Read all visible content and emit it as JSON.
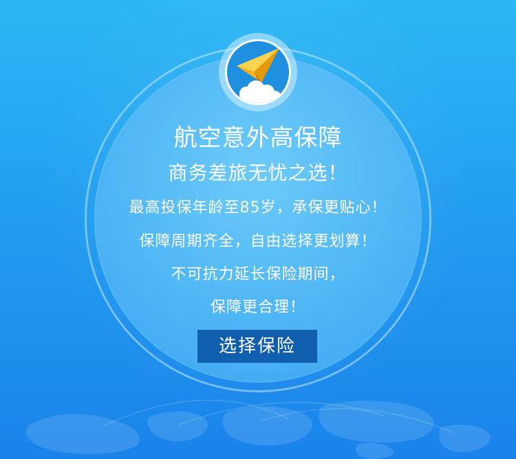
{
  "hero": {
    "title": "航空意外高保障",
    "subtitle": "商务差旅无忧之选！",
    "lines": [
      "最高投保年龄至85岁，承保更贴心！",
      "保障周期齐全，自由选择更划算！",
      "不可抗力延长保险期间，",
      "保障更合理！"
    ],
    "cta_label": "选择保险"
  },
  "icons": {
    "logo": "paper-plane-icon",
    "decoration": "world-map"
  },
  "colors": {
    "background_top": "#2bb7f4",
    "background_bottom": "#1a83ea",
    "circle": "#4fb6f5",
    "button": "#0f5fae",
    "plane": "#f7b21a"
  }
}
